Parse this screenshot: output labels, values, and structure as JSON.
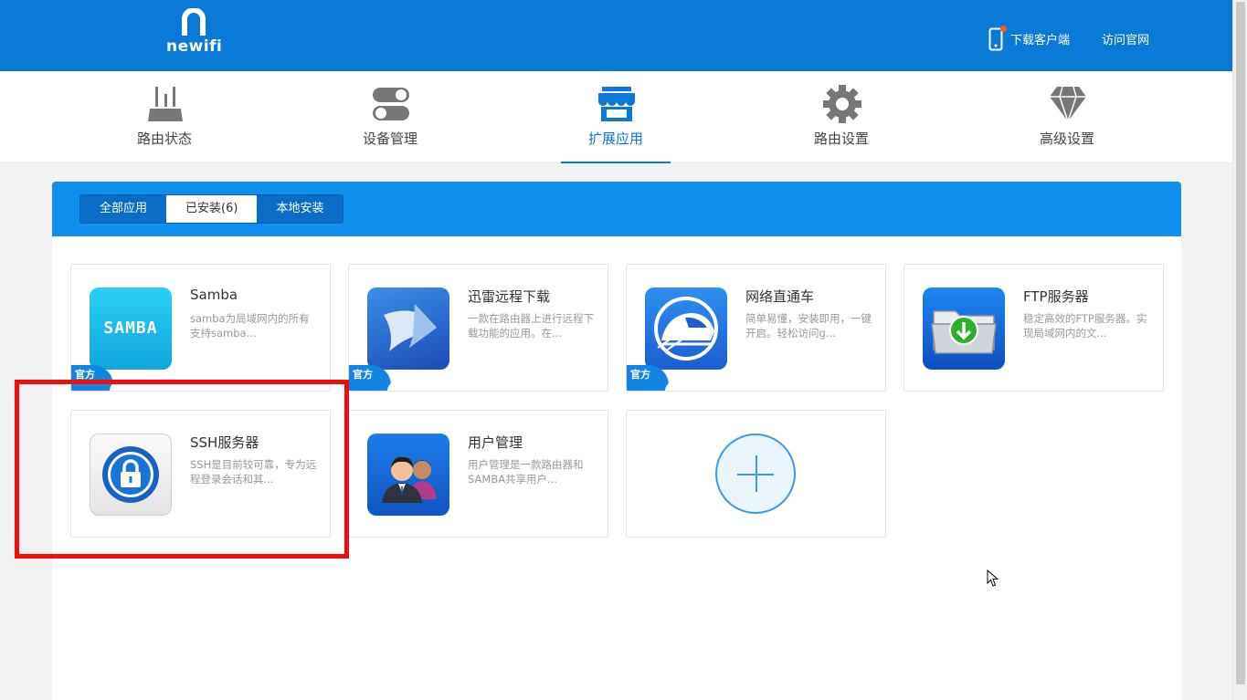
{
  "header": {
    "logo_text": "newifi",
    "download_client": "下载客户端",
    "visit_site": "访问官网"
  },
  "nav": [
    {
      "label": "路由状态",
      "icon": "router-icon"
    },
    {
      "label": "设备管理",
      "icon": "toggle-devices-icon"
    },
    {
      "label": "扩展应用",
      "icon": "store-icon",
      "active": true
    },
    {
      "label": "路由设置",
      "icon": "gear-icon"
    },
    {
      "label": "高级设置",
      "icon": "diamond-icon"
    }
  ],
  "tabs": [
    {
      "label": "全部应用"
    },
    {
      "label": "已安装(6)",
      "active": true
    },
    {
      "label": "本地安装"
    }
  ],
  "apps": [
    {
      "title": "Samba",
      "desc": "samba为局域网内的所有支持samba...",
      "badge": "官方",
      "icon": "samba-icon"
    },
    {
      "title": "迅雷远程下载",
      "desc": "一款在路由器上进行远程下载功能的应用。在...",
      "badge": "官方",
      "icon": "xunlei-arrow-icon"
    },
    {
      "title": "网络直通车",
      "desc": "简单易懂，安装即用，一键开启。轻松访问g...",
      "badge": "官方",
      "icon": "train-icon"
    },
    {
      "title": "FTP服务器",
      "desc": "稳定高效的FTP服务器。实现局域网内的文...",
      "icon": "ftp-folder-icon"
    },
    {
      "title": "SSH服务器",
      "desc": "SSH是目前较可靠，专为远程登录会话和其...",
      "icon": "lock-icon"
    },
    {
      "title": "用户管理",
      "desc": "用户管理是一款路由器和SAMBA共享用户...",
      "icon": "users-icon"
    }
  ],
  "samba_logo_text": "SAMBA",
  "colors": {
    "brand_blue": "#0b7ad6",
    "panel_blue": "#1090ec",
    "highlight_red": "#f20d0d"
  }
}
